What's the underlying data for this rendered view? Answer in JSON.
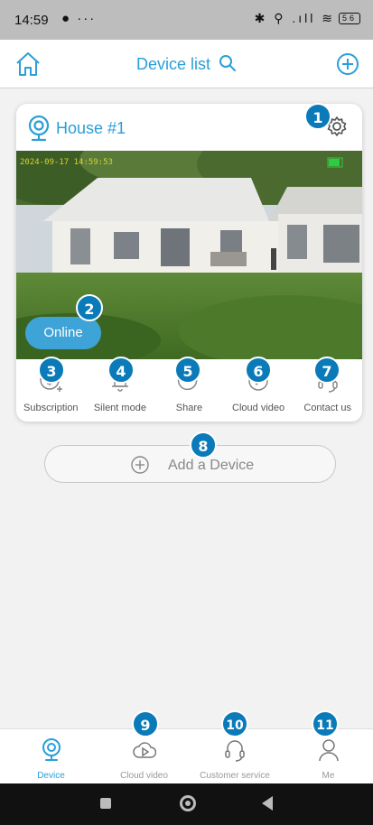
{
  "status_bar": {
    "time": "14:59",
    "left_icons": "● ···",
    "right_icons": "✱ ⚲ .ıll ≋",
    "battery": "56"
  },
  "header": {
    "title": "Device list",
    "icons": [
      "home-icon",
      "search-icon",
      "add-circle-icon"
    ]
  },
  "device": {
    "name": "House #1",
    "timestamp": "2024-09-17 14:59:53",
    "status": "Online",
    "actions": [
      {
        "label": "Subscription",
        "icon": "subscription-icon"
      },
      {
        "label": "Silent mode",
        "icon": "bell-icon"
      },
      {
        "label": "Share",
        "icon": "share-icon"
      },
      {
        "label": "Cloud video",
        "icon": "cloud-video-icon"
      },
      {
        "label": "Contact us",
        "icon": "headset-icon"
      }
    ]
  },
  "add_device": {
    "label": "Add a Device"
  },
  "tabs": [
    {
      "label": "Device",
      "icon": "camera-icon",
      "active": true
    },
    {
      "label": "Cloud video",
      "icon": "cloud-play-icon",
      "active": false
    },
    {
      "label": "Customer service",
      "icon": "headset-icon",
      "active": false
    },
    {
      "label": "Me",
      "icon": "person-icon",
      "active": false
    }
  ],
  "badges": [
    "1",
    "2",
    "3",
    "4",
    "5",
    "6",
    "7",
    "8",
    "9",
    "10",
    "11"
  ],
  "colors": {
    "accent": "#2a9fd8",
    "badge": "#0a7ab8",
    "online_pill": "#3ea3d6"
  }
}
